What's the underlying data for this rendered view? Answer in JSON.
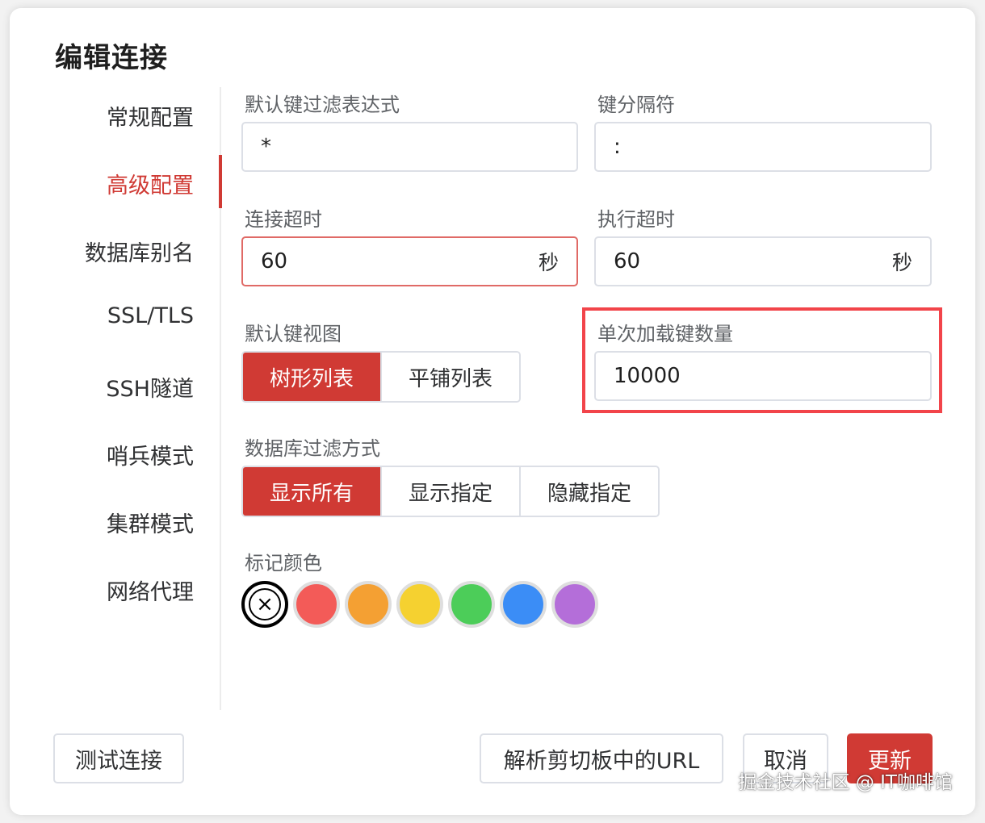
{
  "dialog": {
    "title": "编辑连接"
  },
  "sidebar": {
    "items": [
      {
        "label": "常规配置",
        "active": false
      },
      {
        "label": "高级配置",
        "active": true
      },
      {
        "label": "数据库别名",
        "active": false
      },
      {
        "label": "SSL/TLS",
        "active": false
      },
      {
        "label": "SSH隧道",
        "active": false
      },
      {
        "label": "哨兵模式",
        "active": false
      },
      {
        "label": "集群模式",
        "active": false
      },
      {
        "label": "网络代理",
        "active": false
      }
    ]
  },
  "form": {
    "key_filter": {
      "label": "默认键过滤表达式",
      "value": "*"
    },
    "key_separator": {
      "label": "键分隔符",
      "value": ":"
    },
    "conn_timeout": {
      "label": "连接超时",
      "value": "60",
      "unit": "秒"
    },
    "exec_timeout": {
      "label": "执行超时",
      "value": "60",
      "unit": "秒"
    },
    "key_view": {
      "label": "默认键视图",
      "options": [
        "树形列表",
        "平铺列表"
      ],
      "selected": "树形列表"
    },
    "load_size": {
      "label": "单次加载键数量",
      "value": "10000"
    },
    "db_filter": {
      "label": "数据库过滤方式",
      "options": [
        "显示所有",
        "显示指定",
        "隐藏指定"
      ],
      "selected": "显示所有"
    },
    "mark_color": {
      "label": "标记颜色",
      "none_icon": "×",
      "selected": "none",
      "colors": [
        "#f35b58",
        "#f4a033",
        "#f5d130",
        "#4ccd59",
        "#3b8df6",
        "#b46ed9"
      ]
    }
  },
  "footer": {
    "test_label": "测试连接",
    "parse_label": "解析剪切板中的URL",
    "cancel_label": "取消",
    "update_label": "更新"
  },
  "watermark": "掘金技术社区 @ IT咖啡馆",
  "colors": {
    "accent": "#d03a34",
    "highlight": "#f2444a"
  }
}
